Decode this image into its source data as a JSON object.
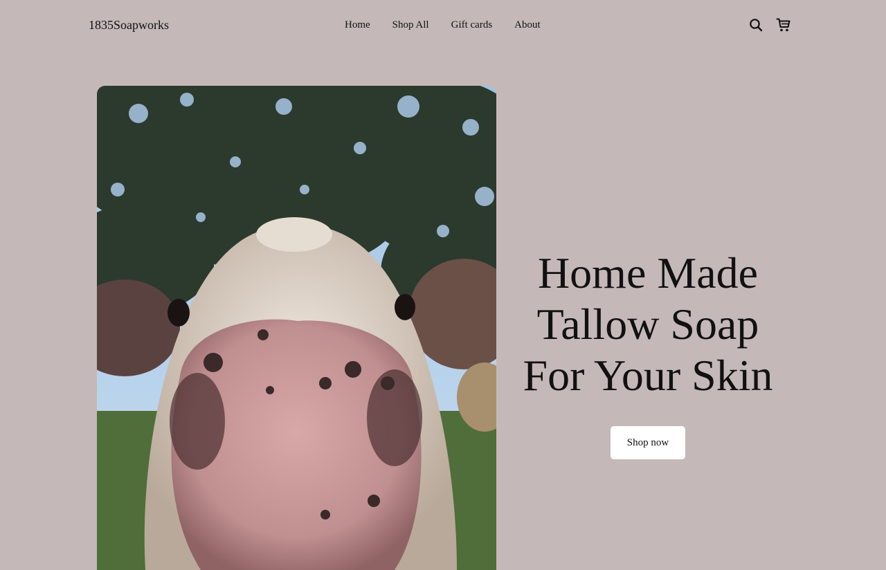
{
  "header": {
    "brand": "1835Soapworks",
    "nav": [
      {
        "label": "Home"
      },
      {
        "label": "Shop All"
      },
      {
        "label": "Gift cards"
      },
      {
        "label": "About"
      }
    ],
    "icons": [
      "search-icon",
      "cart-icon"
    ]
  },
  "hero": {
    "image_subject": "cow-nose-closeup-photo",
    "title_lines": [
      "Home Made",
      "Tallow Soap",
      "For Your Skin"
    ],
    "cta_label": "Shop now"
  },
  "colors": {
    "page_background": "#c5b8b8",
    "text": "#111111",
    "button_background": "#ffffff"
  }
}
